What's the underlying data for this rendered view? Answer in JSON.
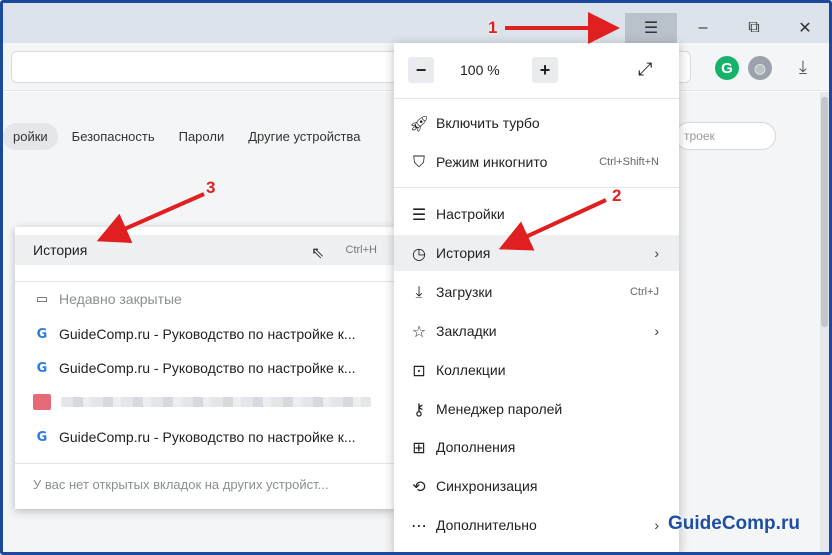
{
  "window": {
    "menu_icon": "hamburger-menu-icon",
    "minimize": "–",
    "restore": "⧉",
    "close": "✕"
  },
  "toolbar": {
    "extension_g": "G",
    "globe_icon": "globe-icon",
    "download_icon": "download-icon"
  },
  "settings_tabs": [
    "ройки",
    "Безопасность",
    "Пароли",
    "Другие устройства"
  ],
  "settings_search_placeholder": "троек",
  "history_submenu": {
    "title": "История",
    "shortcut": "Ctrl+H",
    "recently_closed": "Недавно закрытые",
    "items": [
      "GuideComp.ru - Руководство по настройке к...",
      "GuideComp.ru - Руководство по настройке к...",
      "GuideComp.ru - Руководство по настройке к..."
    ],
    "footer": "У вас нет открытых вкладок на других устройст..."
  },
  "main_menu": {
    "zoom_minus": "−",
    "zoom_value": "100 %",
    "zoom_plus": "+",
    "fullscreen_icon": "fullscreen-icon",
    "items": [
      {
        "label": "Включить турбо",
        "shortcut": ""
      },
      {
        "label": "Режим инкогнито",
        "shortcut": "Ctrl+Shift+N"
      },
      {
        "label": "Настройки",
        "shortcut": ""
      },
      {
        "label": "История",
        "shortcut": ""
      },
      {
        "label": "Загрузки",
        "shortcut": "Ctrl+J"
      },
      {
        "label": "Закладки",
        "shortcut": ""
      },
      {
        "label": "Коллекции",
        "shortcut": ""
      },
      {
        "label": "Менеджер паролей",
        "shortcut": ""
      },
      {
        "label": "Дополнения",
        "shortcut": ""
      },
      {
        "label": "Синхронизация",
        "shortcut": ""
      },
      {
        "label": "Дополнительно",
        "shortcut": ""
      }
    ]
  },
  "annotations": {
    "step1": "1",
    "step2": "2",
    "step3": "3",
    "arrow_color": "#e02020"
  },
  "watermark": "GuideComp.ru"
}
